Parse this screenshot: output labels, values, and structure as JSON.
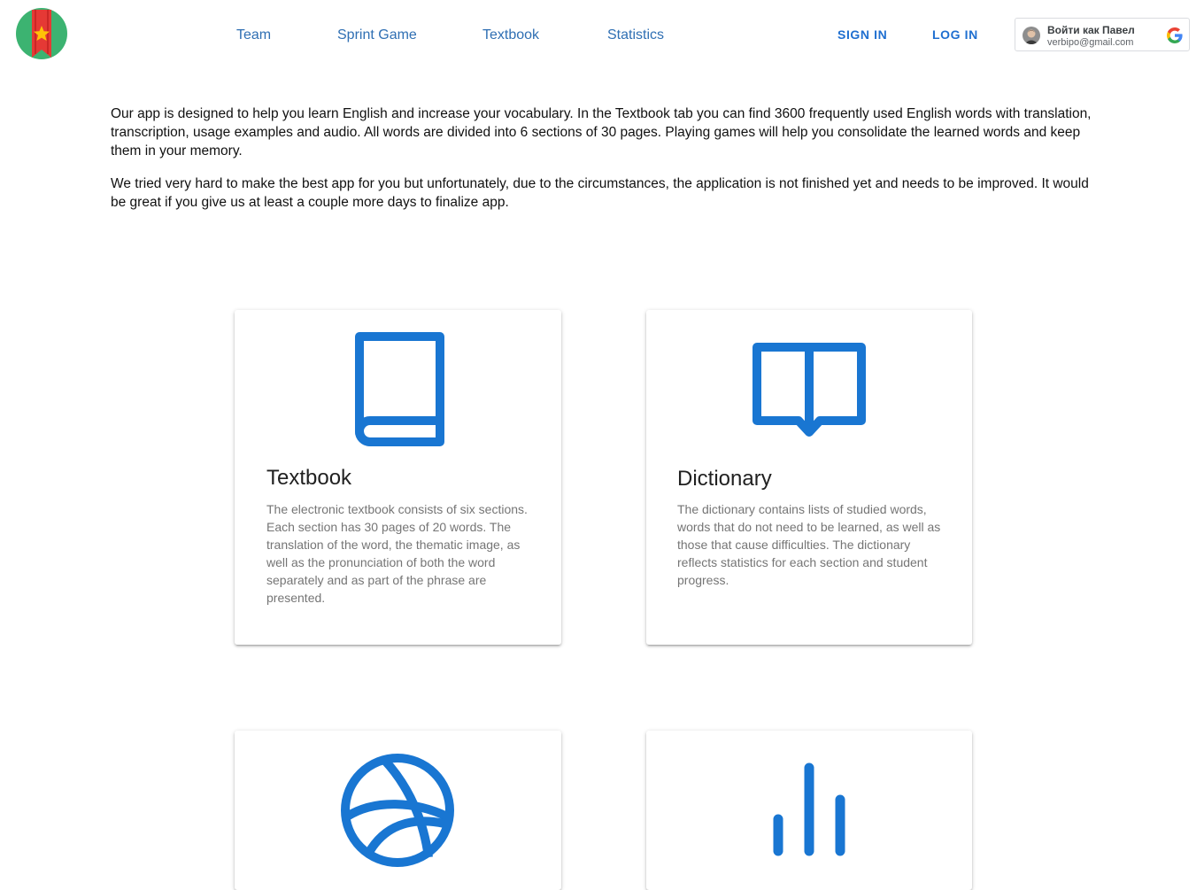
{
  "header": {
    "logo_icon": "bookmark-star-logo",
    "nav": [
      "Team",
      "Sprint Game",
      "Textbook",
      "Statistics"
    ],
    "sign_in": "SIGN IN",
    "log_in": "LOG IN",
    "google": {
      "name": "Войти как Павел",
      "email": "verbipo@gmail.com",
      "icon": "google-icon"
    }
  },
  "intro": {
    "paragraphs": [
      "Our app is designed to help you learn English and increase your vocabulary. In the Textbook tab you can find 3600 frequently used English words with translation, transcription, usage examples and audio. All words are divided into 6 sections of 30 pages. Playing games will help you consolidate the learned words and keep them in your memory.",
      "We tried very hard to make the best app for you but unfortunately, due to the circumstances, the application is not finished yet and needs to be improved. It would be great if you give us at least a couple more days to finalize app."
    ]
  },
  "cards": [
    {
      "icon": "book-icon",
      "title": "Textbook",
      "text": "The electronic textbook consists of six sections. Each section has 30 pages of 20 words. The translation of the word, the thematic image, as well as the pronunciation of both the word separately and as part of the phrase are presented."
    },
    {
      "icon": "open-book-icon",
      "title": "Dictionary",
      "text": "The dictionary contains lists of studied words, words that do not need to be learned, as well as those that cause difficulties. The dictionary reflects statistics for each section and student progress."
    },
    {
      "icon": "basketball-icon",
      "title": "",
      "text": ""
    },
    {
      "icon": "bar-chart-icon",
      "title": "",
      "text": ""
    }
  ],
  "colors": {
    "accent": "#1976d2",
    "nav_link": "#2f6fb3",
    "logo_circle": "#3cb371",
    "logo_ribbon": "#e53935",
    "logo_star": "#ffc107"
  }
}
